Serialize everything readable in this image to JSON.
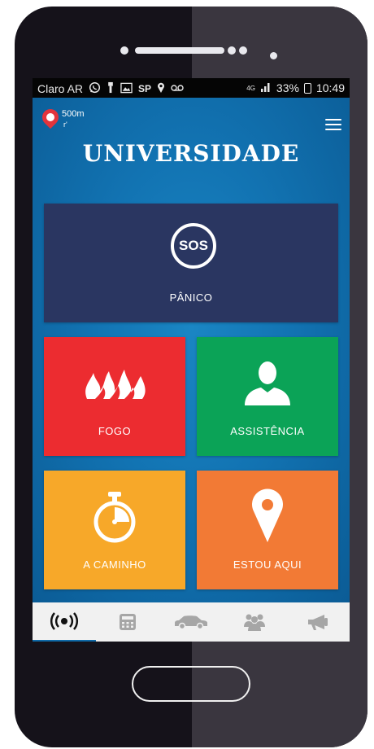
{
  "status_bar": {
    "carrier": "Claro AR",
    "sp_label": "SP",
    "network": "4G",
    "battery_percent": "33%",
    "time": "10:49"
  },
  "header": {
    "distance": "500m",
    "distance_sub": "r'",
    "title": "UNIVERSIDADE"
  },
  "tiles": {
    "panic": {
      "icon_text": "SOS",
      "label": "PÂNICO",
      "color": "#2a3661"
    },
    "fire": {
      "label": "FOGO",
      "color": "#ec2c30"
    },
    "assistance": {
      "label": "ASSISTÊNCIA",
      "color": "#0ba357"
    },
    "on_the_way": {
      "label": "A CAMINHO",
      "color": "#f7a829"
    },
    "here": {
      "label": "ESTOU AQUI",
      "color": "#f27a35"
    }
  },
  "tabbar": {
    "items": [
      {
        "icon": "broadcast-icon",
        "active": true
      },
      {
        "icon": "calculator-icon",
        "active": false
      },
      {
        "icon": "car-icon",
        "active": false
      },
      {
        "icon": "group-icon",
        "active": false
      },
      {
        "icon": "megaphone-icon",
        "active": false
      }
    ]
  },
  "colors": {
    "app_background": "#0f6aa8",
    "active_tab": "#0f6aa8"
  }
}
